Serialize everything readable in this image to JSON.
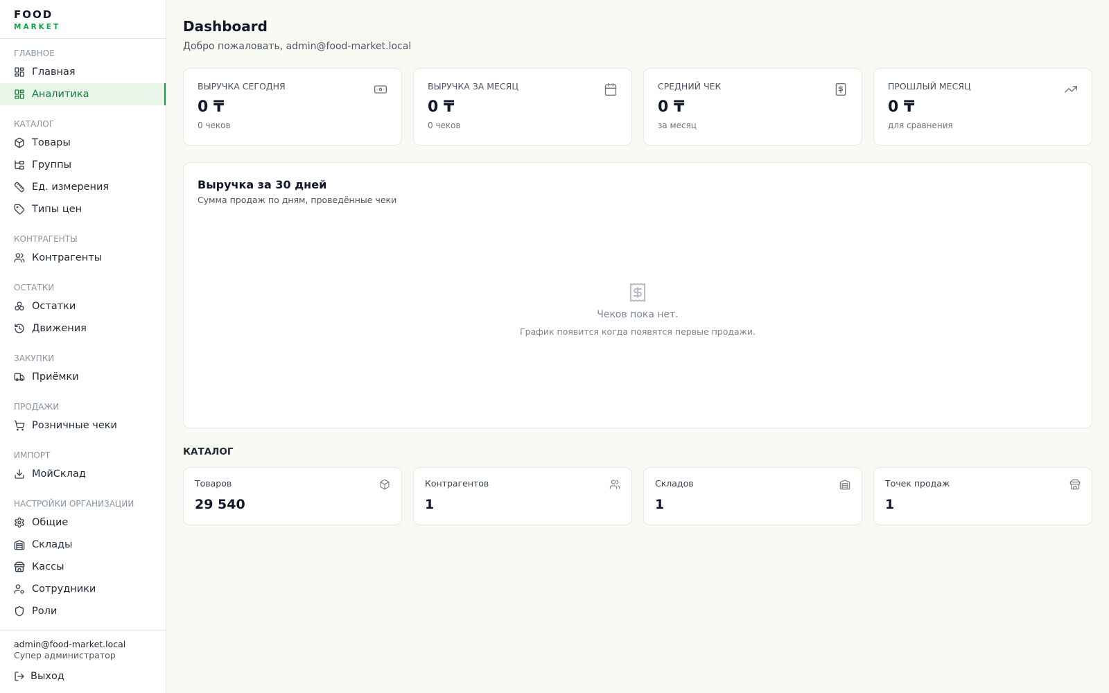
{
  "brand": {
    "top": "FOOD",
    "bottom": "MARKET",
    "accent": "#16a34a"
  },
  "sidebar": {
    "sections": [
      {
        "title": "ГЛАВНОЕ",
        "items": [
          {
            "label": "Главная",
            "icon": "dashboard-icon"
          },
          {
            "label": "Аналитика",
            "icon": "dashboard-icon",
            "active": true
          }
        ]
      },
      {
        "title": "КАТАЛОГ",
        "items": [
          {
            "label": "Товары",
            "icon": "box-icon"
          },
          {
            "label": "Группы",
            "icon": "tree-icon"
          },
          {
            "label": "Ед. измерения",
            "icon": "ruler-icon"
          },
          {
            "label": "Типы цен",
            "icon": "tag-icon"
          }
        ]
      },
      {
        "title": "КОНТРАГЕНТЫ",
        "items": [
          {
            "label": "Контрагенты",
            "icon": "users-icon"
          }
        ]
      },
      {
        "title": "ОСТАТКИ",
        "items": [
          {
            "label": "Остатки",
            "icon": "boxes-icon"
          },
          {
            "label": "Движения",
            "icon": "history-icon"
          }
        ]
      },
      {
        "title": "ЗАКУПКИ",
        "items": [
          {
            "label": "Приёмки",
            "icon": "truck-icon"
          }
        ]
      },
      {
        "title": "ПРОДАЖИ",
        "items": [
          {
            "label": "Розничные чеки",
            "icon": "cart-icon"
          }
        ]
      },
      {
        "title": "ИМПОРТ",
        "items": [
          {
            "label": "МойСклад",
            "icon": "download-icon"
          }
        ]
      },
      {
        "title": "НАСТРОЙКИ ОРГАНИЗАЦИИ",
        "items": [
          {
            "label": "Общие",
            "icon": "gear-icon"
          },
          {
            "label": "Склады",
            "icon": "warehouse-icon"
          },
          {
            "label": "Кассы",
            "icon": "store-icon"
          },
          {
            "label": "Сотрудники",
            "icon": "user-cog-icon"
          },
          {
            "label": "Роли",
            "icon": "shield-icon"
          }
        ]
      }
    ],
    "user": {
      "email": "admin@food-market.local",
      "role": "Супер администратор"
    },
    "logout_label": "Выход"
  },
  "header": {
    "title": "Dashboard",
    "subtitle": "Добро пожаловать, admin@food-market.local"
  },
  "kpis": [
    {
      "label": "ВЫРУЧКА СЕГОДНЯ",
      "value": "0 ₸",
      "sub": "0 чеков",
      "icon": "banknote-icon"
    },
    {
      "label": "ВЫРУЧКА ЗА МЕСЯЦ",
      "value": "0 ₸",
      "sub": "0 чеков",
      "icon": "calendar-icon"
    },
    {
      "label": "СРЕДНИЙ ЧЕК",
      "value": "0 ₸",
      "sub": "за месяц",
      "icon": "receipt-icon"
    },
    {
      "label": "ПРОШЛЫЙ МЕСЯЦ",
      "value": "0 ₸",
      "sub": "для сравнения",
      "icon": "trending-up-icon"
    }
  ],
  "revenue_chart": {
    "title": "Выручка за 30 дней",
    "subtitle": "Сумма продаж по дням, проведённые чеки",
    "empty_title": "Чеков пока нет.",
    "empty_text": "График появится когда появятся первые продажи."
  },
  "catalog": {
    "heading": "КАТАЛОГ",
    "cards": [
      {
        "label": "Товаров",
        "value": "29 540",
        "icon": "box-icon"
      },
      {
        "label": "Контрагентов",
        "value": "1",
        "icon": "users-icon"
      },
      {
        "label": "Складов",
        "value": "1",
        "icon": "warehouse-icon"
      },
      {
        "label": "Точек продаж",
        "value": "1",
        "icon": "store-icon"
      }
    ]
  }
}
